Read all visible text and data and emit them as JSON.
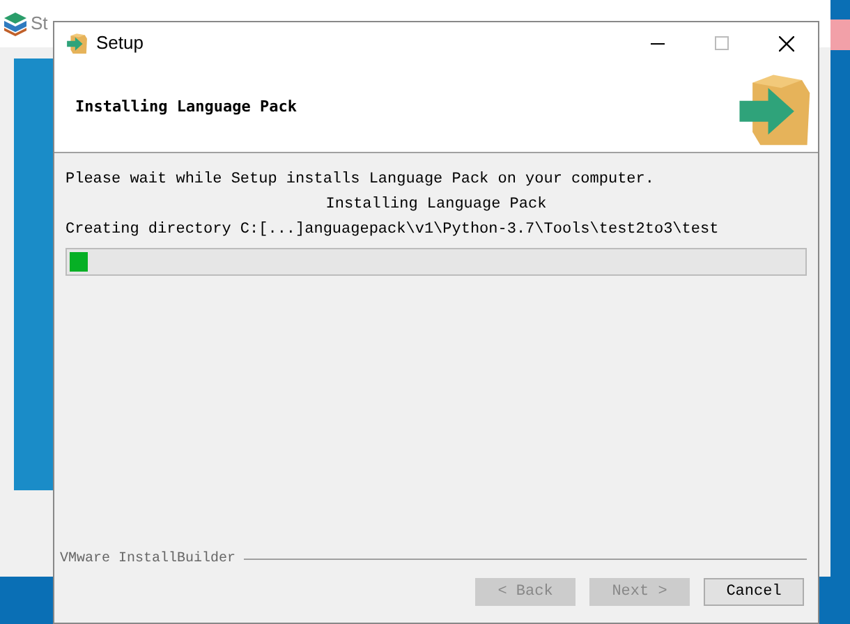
{
  "background_window": {
    "title": "St"
  },
  "dialog": {
    "title": "Setup",
    "header": "Installing Language Pack",
    "messages": [
      "Please wait while Setup installs Language Pack on your computer."
    ],
    "status": "Installing Language Pack",
    "detail": "Creating directory C:[...]anguagepack\\v1\\Python-3.7\\Tools\\test2to3\\test",
    "progress": {
      "level": 0.025
    },
    "brand": "VMware InstallBuilder",
    "buttons": [
      {
        "label": "< Back",
        "disabled": true
      },
      {
        "label": "Next >",
        "disabled": true
      },
      {
        "label": "Cancel",
        "disabled": false
      }
    ]
  }
}
